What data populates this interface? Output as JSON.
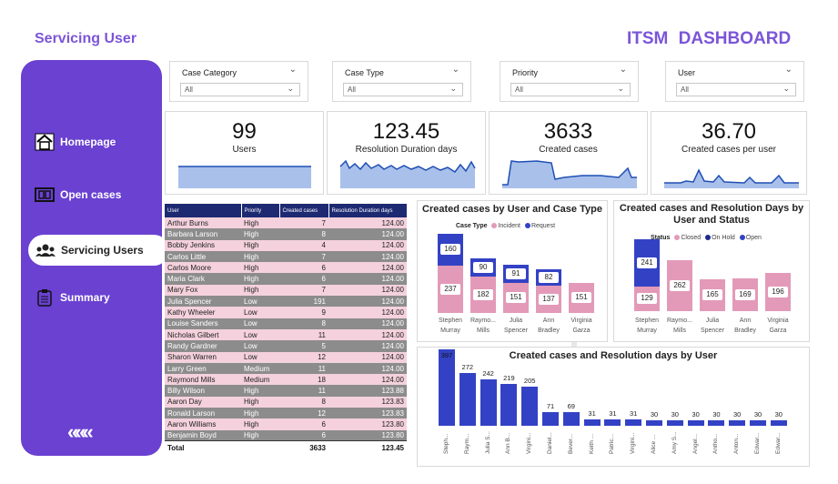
{
  "header": {
    "page_title": "Servicing User",
    "brand": "ITSM  DASHBOARD"
  },
  "sidebar": {
    "items": [
      {
        "label": "Homepage",
        "icon": "home-icon"
      },
      {
        "label": "Open cases",
        "icon": "cases-icon"
      },
      {
        "label": "Servicing Users",
        "icon": "users-icon"
      },
      {
        "label": "Summary",
        "icon": "clipboard-icon"
      }
    ],
    "back": "«««"
  },
  "filters": [
    {
      "label": "Case Category",
      "value": "All"
    },
    {
      "label": "Case Type",
      "value": "All"
    },
    {
      "label": "Priority",
      "value": "All"
    },
    {
      "label": "User",
      "value": "All"
    }
  ],
  "kpis": [
    {
      "value": "99",
      "label": "Users"
    },
    {
      "value": "123.45",
      "label": "Resolution Duration days"
    },
    {
      "value": "3633",
      "label": "Created cases"
    },
    {
      "value": "36.70",
      "label": "Created cases per user"
    }
  ],
  "table": {
    "columns": [
      "User",
      "Priority",
      "Created cases",
      "Resolution Duration days"
    ],
    "rows": [
      [
        "Arthur Burns",
        "High",
        "7",
        "124.00"
      ],
      [
        "Barbara Larson",
        "High",
        "8",
        "124.00"
      ],
      [
        "Bobby Jenkins",
        "High",
        "4",
        "124.00"
      ],
      [
        "Carlos Little",
        "High",
        "7",
        "124.00"
      ],
      [
        "Carlos Moore",
        "High",
        "6",
        "124.00"
      ],
      [
        "Maria Clark",
        "High",
        "6",
        "124.00"
      ],
      [
        "Mary Fox",
        "High",
        "7",
        "124.00"
      ],
      [
        "Julia Spencer",
        "Low",
        "191",
        "124.00"
      ],
      [
        "Kathy Wheeler",
        "Low",
        "9",
        "124.00"
      ],
      [
        "Louise Sanders",
        "Low",
        "8",
        "124.00"
      ],
      [
        "Nicholas Gilbert",
        "Low",
        "11",
        "124.00"
      ],
      [
        "Randy Gardner",
        "Low",
        "5",
        "124.00"
      ],
      [
        "Sharon Warren",
        "Low",
        "12",
        "124.00"
      ],
      [
        "Larry Green",
        "Medium",
        "11",
        "124.00"
      ],
      [
        "Raymond Mills",
        "Medium",
        "18",
        "124.00"
      ],
      [
        "Billy Wilson",
        "High",
        "11",
        "123.88"
      ],
      [
        "Aaron Day",
        "High",
        "8",
        "123.83"
      ],
      [
        "Ronald Larson",
        "High",
        "12",
        "123.83"
      ],
      [
        "Aaron Williams",
        "High",
        "6",
        "123.80"
      ],
      [
        "Benjamin Boyd",
        "High",
        "6",
        "123.80"
      ]
    ],
    "total": [
      "Total",
      "",
      "3633",
      "123.45"
    ]
  },
  "chart_data": [
    {
      "type": "bar",
      "title": "Created cases by User and Case Type",
      "legend_title": "Case Type",
      "categories": [
        "Stephen Murray",
        "Raymo... Mills",
        "Julia Spencer",
        "Ann Bradley",
        "Virginia Garza"
      ],
      "series": [
        {
          "name": "Incident",
          "values": [
            237,
            182,
            151,
            137,
            151
          ]
        },
        {
          "name": "Request",
          "values": [
            160,
            90,
            91,
            82,
            null
          ]
        }
      ],
      "colors": {
        "Incident": "#e39ab8",
        "Request": "#3342c5"
      }
    },
    {
      "type": "bar",
      "title": "Created cases and Resolution Days by User and Status",
      "legend_title": "Status",
      "categories": [
        "Stephen Murray",
        "Raymo... Mills",
        "Julia Spencer",
        "Ann Bradley",
        "Virginia Garza"
      ],
      "series": [
        {
          "name": "Closed",
          "values": [
            129,
            262,
            165,
            169,
            196
          ]
        },
        {
          "name": "On Hold",
          "values": [
            null,
            null,
            null,
            null,
            null
          ]
        },
        {
          "name": "Open",
          "values": [
            241,
            null,
            null,
            null,
            null
          ]
        }
      ],
      "colors": {
        "Closed": "#e39ab8",
        "On Hold": "#1d2a8a",
        "Open": "#3342c5"
      }
    },
    {
      "type": "bar",
      "title": "Created cases and Resolution days by User",
      "categories": [
        "Steph...",
        "Raym...",
        "Julia S...",
        "Ann B...",
        "Virgini...",
        "Daniel...",
        "Bever...",
        "Keith ...",
        "Patric...",
        "Virgini...",
        "Alice ...",
        "Amy S...",
        "Angel...",
        "Antho...",
        "Anton...",
        "Edwar...",
        "Edwar..."
      ],
      "values": [
        397,
        272,
        242,
        219,
        205,
        71,
        69,
        31,
        31,
        31,
        30,
        30,
        30,
        30,
        30,
        30,
        30
      ],
      "color": "#3342c5"
    }
  ]
}
